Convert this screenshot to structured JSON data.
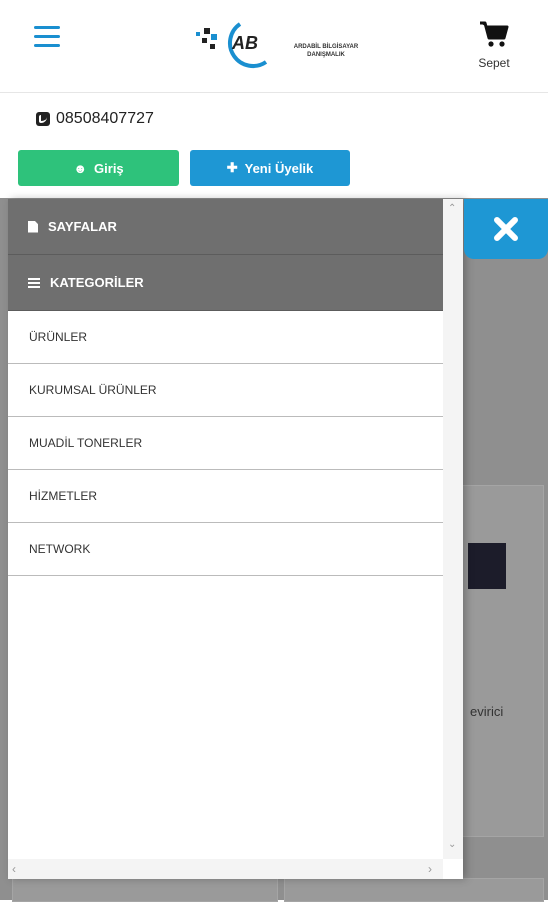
{
  "header": {
    "menu_icon": "hamburger-icon",
    "logo_letters": "AB",
    "logo_line1": "ARDABİL BİLGİSAYAR",
    "logo_line2": "DANIŞMALIK",
    "cart_icon": "cart-icon",
    "cart_label": "Sepet"
  },
  "contact": {
    "phone_icon": "phone-icon",
    "phone": "08508407727"
  },
  "actions": {
    "login_label": "Giriş",
    "register_label": "Yeni Üyelik",
    "login_color": "#2ec27b",
    "register_color": "#1e97d4"
  },
  "drawer": {
    "sections": [
      {
        "label": "SAYFALAR",
        "icon": "document-icon"
      },
      {
        "label": "KATEGORİLER",
        "icon": "list-icon"
      }
    ],
    "items": [
      {
        "label": "ÜRÜNLER"
      },
      {
        "label": "KURUMSAL ÜRÜNLER"
      },
      {
        "label": "MUADİL TONERLER"
      },
      {
        "label": "HİZMETLER"
      },
      {
        "label": "NETWORK"
      }
    ],
    "close_icon": "close-icon"
  },
  "background": {
    "partial_text": "evirici"
  }
}
